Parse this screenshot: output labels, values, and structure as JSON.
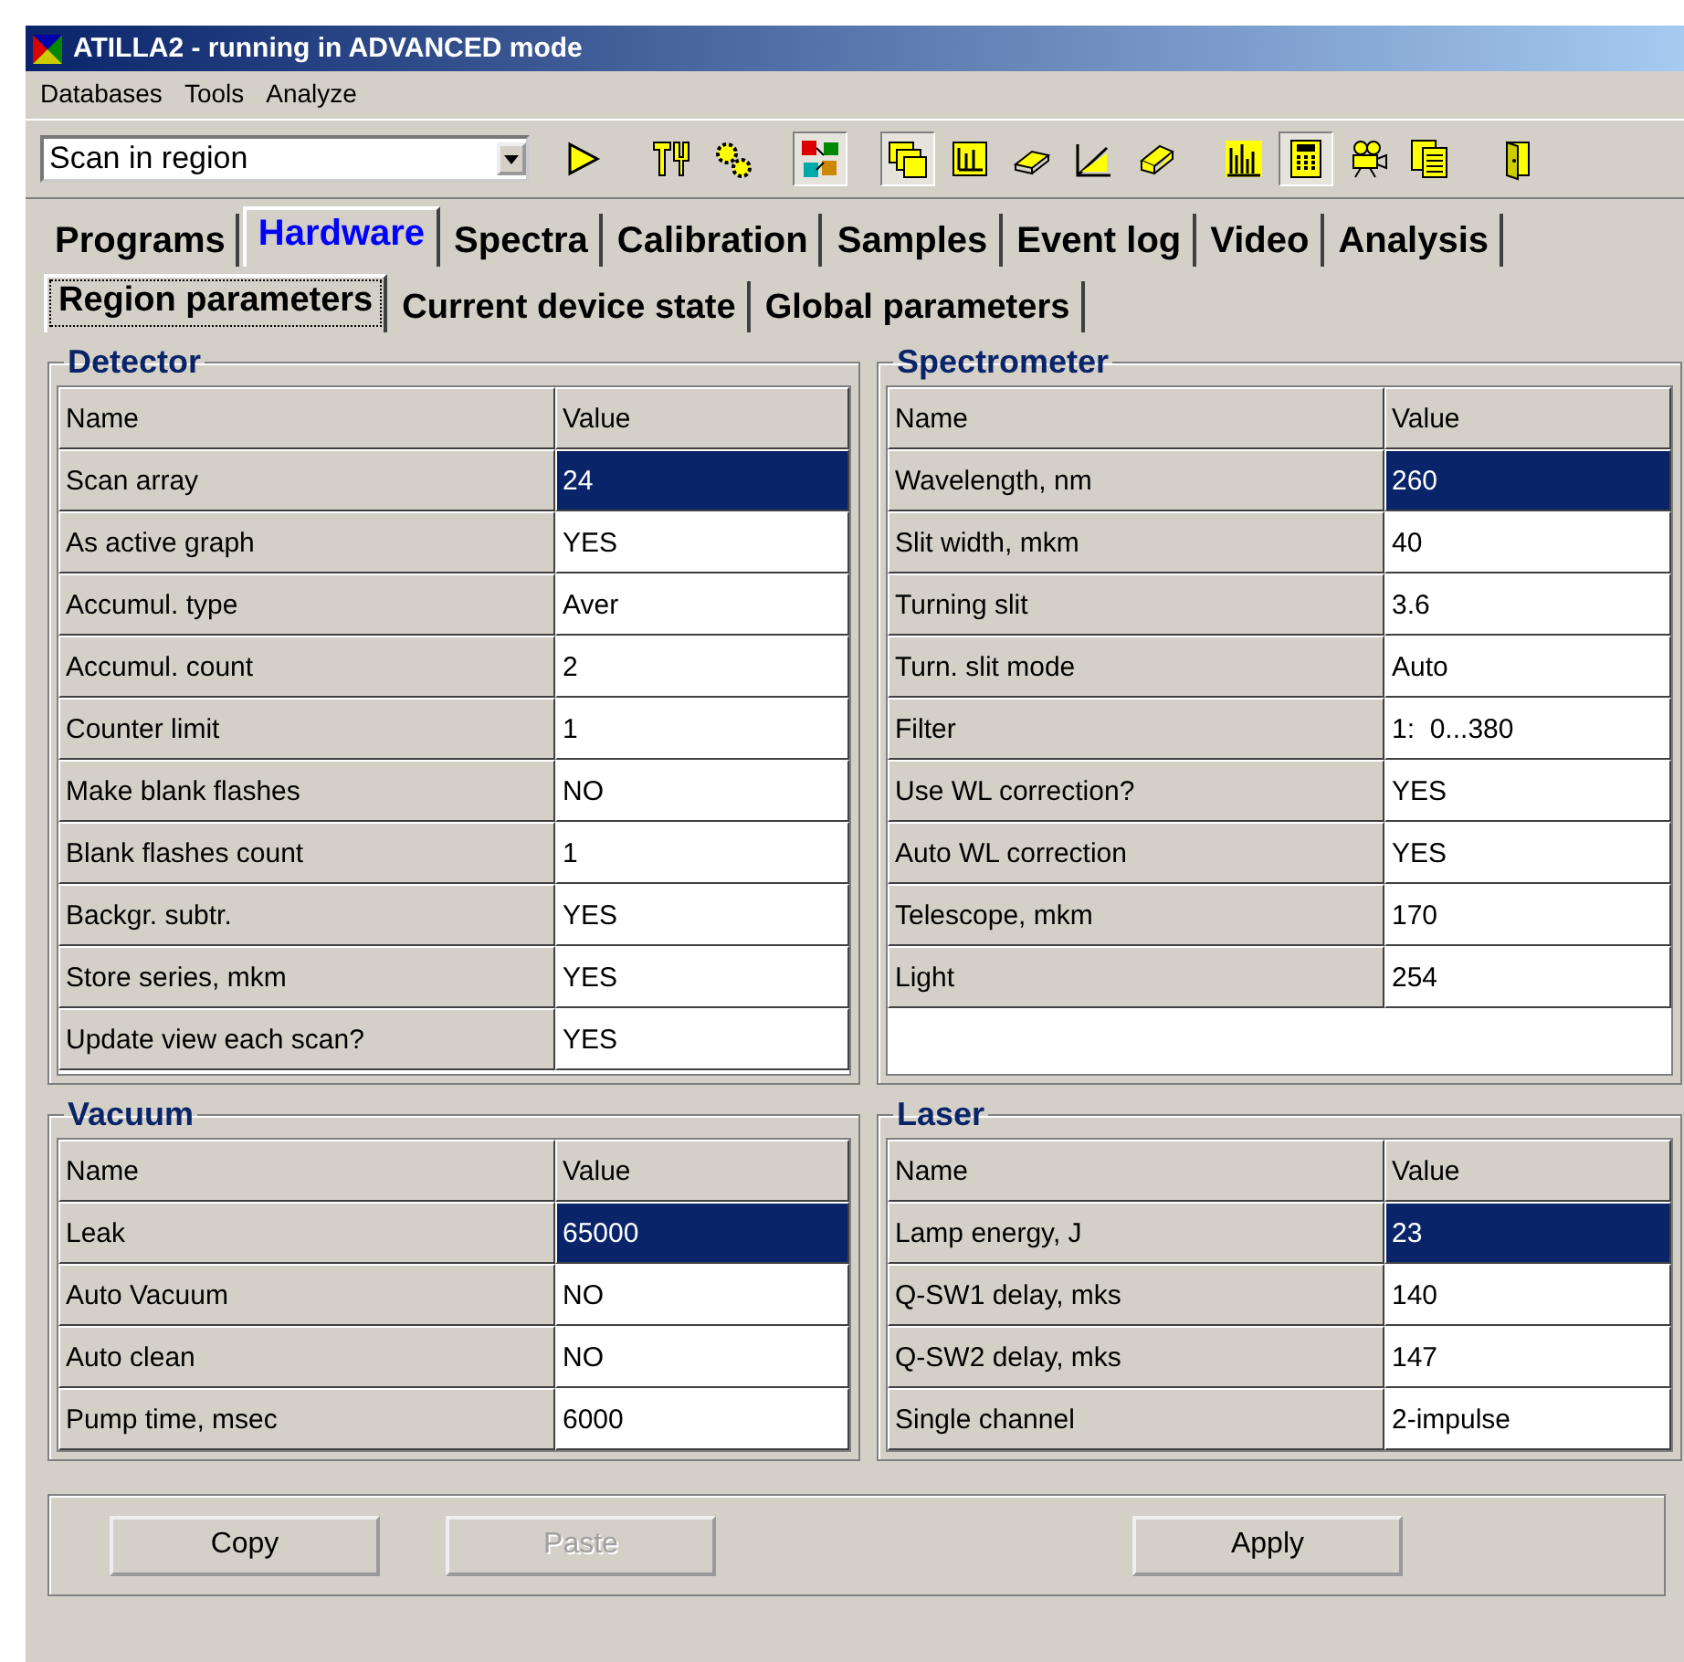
{
  "window": {
    "title": "ATILLA2 - running in ADVANCED mode"
  },
  "menu": [
    "Databases",
    "Tools",
    "Analyze"
  ],
  "toolbar": {
    "combo": {
      "value": "Scan in region"
    },
    "tool_groups": [
      [
        {
          "kind": "play",
          "pressed": false
        }
      ],
      [
        {
          "kind": "tools",
          "pressed": false
        },
        {
          "kind": "gears",
          "pressed": false
        }
      ],
      [
        {
          "kind": "colorblocks",
          "pressed": true
        }
      ],
      [
        {
          "kind": "windows",
          "pressed": true
        },
        {
          "kind": "chart",
          "pressed": false
        },
        {
          "kind": "eraser",
          "pressed": false
        },
        {
          "kind": "angle",
          "pressed": false
        },
        {
          "kind": "eraser2",
          "pressed": false
        }
      ],
      [
        {
          "kind": "bars",
          "pressed": false
        },
        {
          "kind": "calculator",
          "pressed": true
        },
        {
          "kind": "camera",
          "pressed": false
        },
        {
          "kind": "pages",
          "pressed": false
        }
      ],
      [
        {
          "kind": "door",
          "pressed": false
        }
      ]
    ]
  },
  "tabs": [
    {
      "label": "Programs",
      "selected": false
    },
    {
      "label": "Hardware",
      "selected": true
    },
    {
      "label": "Spectra",
      "selected": false
    },
    {
      "label": "Calibration",
      "selected": false
    },
    {
      "label": "Samples",
      "selected": false
    },
    {
      "label": "Event log",
      "selected": false
    },
    {
      "label": "Video",
      "selected": false
    },
    {
      "label": "Analysis",
      "selected": false
    }
  ],
  "subtabs": [
    {
      "label": "Region parameters",
      "selected": true
    },
    {
      "label": "Current device state",
      "selected": false
    },
    {
      "label": "Global parameters",
      "selected": false
    }
  ],
  "panels": [
    {
      "title": "Detector",
      "columns": [
        "Name",
        "Value"
      ],
      "rows": [
        {
          "name": "Scan array",
          "value": "24",
          "selected": true
        },
        {
          "name": "As active graph",
          "value": "YES",
          "selected": false
        },
        {
          "name": "Accumul. type",
          "value": "Aver",
          "selected": false
        },
        {
          "name": "Accumul. count",
          "value": "2",
          "selected": false
        },
        {
          "name": "Counter limit",
          "value": "1",
          "selected": false
        },
        {
          "name": "Make blank flashes",
          "value": "NO",
          "selected": false
        },
        {
          "name": "Blank flashes count",
          "value": "1",
          "selected": false
        },
        {
          "name": "Backgr. subtr.",
          "value": "YES",
          "selected": false
        },
        {
          "name": "Store series, mkm",
          "value": "YES",
          "selected": false
        },
        {
          "name": "Update view each scan?",
          "value": "YES",
          "selected": false
        }
      ]
    },
    {
      "title": "Spectrometer",
      "columns": [
        "Name",
        "Value"
      ],
      "rows": [
        {
          "name": "Wavelength, nm",
          "value": "260",
          "selected": true
        },
        {
          "name": "Slit width, mkm",
          "value": "40",
          "selected": false
        },
        {
          "name": "Turning slit",
          "value": "3.6",
          "selected": false
        },
        {
          "name": "Turn. slit mode",
          "value": "Auto",
          "selected": false
        },
        {
          "name": "Filter",
          "value": "1:  0...380",
          "selected": false
        },
        {
          "name": "Use WL correction?",
          "value": "YES",
          "selected": false
        },
        {
          "name": "Auto WL correction",
          "value": "YES",
          "selected": false
        },
        {
          "name": "Telescope, mkm",
          "value": "170",
          "selected": false
        },
        {
          "name": "Light",
          "value": "254",
          "selected": false
        }
      ]
    },
    {
      "title": "Vacuum",
      "columns": [
        "Name",
        "Value"
      ],
      "rows": [
        {
          "name": "Leak",
          "value": "65000",
          "selected": true
        },
        {
          "name": "Auto Vacuum",
          "value": "NO",
          "selected": false
        },
        {
          "name": "Auto clean",
          "value": "NO",
          "selected": false
        },
        {
          "name": "Pump time, msec",
          "value": "6000",
          "selected": false
        }
      ]
    },
    {
      "title": "Laser",
      "columns": [
        "Name",
        "Value"
      ],
      "rows": [
        {
          "name": "Lamp energy, J",
          "value": "23",
          "selected": true
        },
        {
          "name": "Q-SW1 delay, mks",
          "value": "140",
          "selected": false
        },
        {
          "name": "Q-SW2 delay, mks",
          "value": "147",
          "selected": false
        },
        {
          "name": "Single channel",
          "value": "2-impulse",
          "selected": false
        }
      ]
    }
  ],
  "buttons": [
    {
      "label": "Copy",
      "disabled": false
    },
    {
      "label": "Paste",
      "disabled": true
    },
    {
      "label": "Apply",
      "disabled": false
    }
  ]
}
